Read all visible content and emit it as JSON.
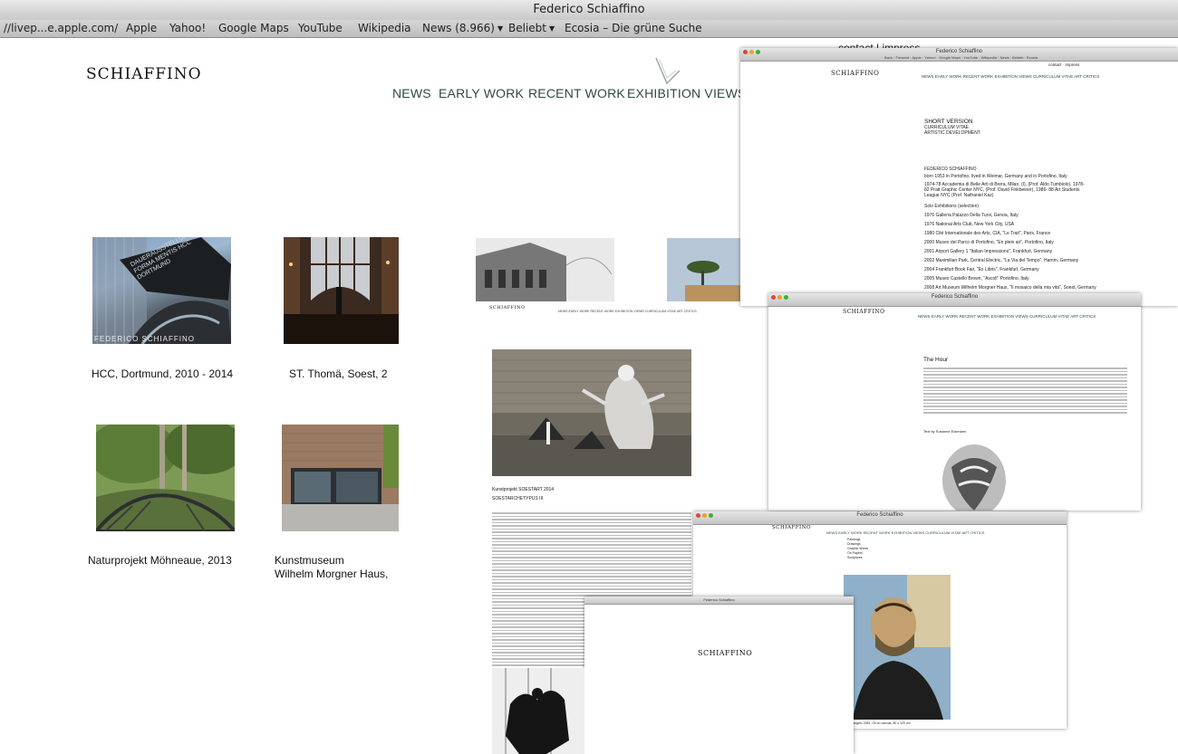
{
  "window": {
    "title": "Federico Schiaffino"
  },
  "bookmarks": [
    {
      "label": "//livep...e.apple.com/",
      "dropdown": false
    },
    {
      "label": "Apple",
      "dropdown": false
    },
    {
      "label": "Yahoo!",
      "dropdown": false
    },
    {
      "label": "Google Maps",
      "dropdown": false
    },
    {
      "label": "YouTube",
      "dropdown": false
    },
    {
      "label": "Wikipedia",
      "dropdown": false
    },
    {
      "label": "News (8.966)",
      "dropdown": true
    },
    {
      "label": "Beliebt",
      "dropdown": true
    },
    {
      "label": "Ecosia – Die grüne Suche",
      "dropdown": false
    }
  ],
  "site": {
    "logo": "SCHIAFFINO",
    "top_links": "contact | impress",
    "nav": [
      "NEWS",
      "EARLY WORK",
      "RECENT WORK",
      "EXHIBITION VIEWS"
    ]
  },
  "gallery": [
    {
      "caption": "HCC, Dortmund, 2010 - 2014",
      "photo_text": "DAUERAUSSTELLUNG FORMA MENTIS HCC DORTMUND",
      "signature": "FEDERICO SCHIAFFINO"
    },
    {
      "caption": "ST. Thomä, Soest, 2"
    },
    {
      "caption": "Naturprojekt Möhneaue, 2013"
    },
    {
      "caption": "Kunstmuseum",
      "caption2": "Wilhelm Morgner Haus,"
    }
  ],
  "shot_vitae": {
    "title": "Federico Schiaffino",
    "logo": "SCHIAFFINO",
    "top_links": "contact · impress",
    "nav": "NEWS   EARLY WORK   RECENT WORK   EXHIBITION VIEWS   CURRICULUM VITAE   ART CRITICS",
    "heading": "SHORT VERSION",
    "sub1": "CURRICULUM VITAE",
    "sub2": "ARTISTIC DEVELOPMENT",
    "name": "FEDERICO SCHIAFFINO",
    "born": "born 1953 in Portofino, lived in Weimar, Germany and in Portofino, Italy",
    "edu": "1974-78 Accademia di Belle Arti di Brera, Milan, (I), (Prof. Aldo Tumbiolo). 1978-82 Pratt Graphic Center NYC, (Prof. David Finkbeiner), 1986- 88 Art Students League NYC (Prof. Nathaniel Kaz)",
    "solo": "Solo Exhibitions (selection)",
    "items": [
      "1976 Galleria Palazzo Della Tursi, Genoa, Italy",
      "1976 National Arts Club, New York City, USA",
      "1980 Cité Internationale des Arts, CIA, \"Le Trait\", Paris, France",
      "2000 Museo del Parco di Portofino, \"En plein air\", Portofino, Italy",
      "2001 Airport Gallery 1 \"Italian Impressions\", Frankfurt, Germany",
      "2002 Maximilian Park, Central Electric, \"La Via del Tempo\", Hamm, Germany",
      "2004 Frankfurt Book Fair, \"Ex Libris\", Frankfurt, Germany",
      "2005 Museo Castello Brown, \"Ascoli\" Portofino, Italy",
      "2008 Art Museum Wilhelm Morgner Haus, \"Il mosaico della mia vita\", Soest, Germany"
    ]
  },
  "shot_hour": {
    "title": "Federico Schiaffino",
    "logo": "SCHIAFFINO",
    "nav": "NEWS   EARLY WORK   RECENT WORK   EXHIBITION VIEWS   CURRICULUM VITAE   ART CRITICS",
    "heading": "The Hour",
    "credit": "Text by Susanne Eckmann"
  },
  "shot_soest": {
    "logo": "SCHIAFFINO",
    "nav": "NEWS   EARLY WORK   RECENT WORK   EXHIBITION VIEWS   CURRICULUM VITAE   ART CRITICS",
    "title": "Kunstprojekt SOESTART 2014",
    "subtitle": "SOESTARCHETYPUS III"
  },
  "shot_early": {
    "title": "Federico Schiaffino",
    "logo": "SCHIAFFINO",
    "nav": "NEWS   EARLY WORK   RECENT WORK   EXHIBITION VIEWS   CURRICULUM VITAE   ART CRITICS",
    "menu": [
      "Paintings",
      "Drawings",
      "Graphic Works",
      "On Papers",
      "Sculptures"
    ],
    "artwork_caption": "Michelangelo 1981, Oil on canvas, 80 x 120 cm"
  },
  "shot_bottom": {
    "title": "Federico Schiaffino",
    "logo": "SCHIAFFINO"
  }
}
